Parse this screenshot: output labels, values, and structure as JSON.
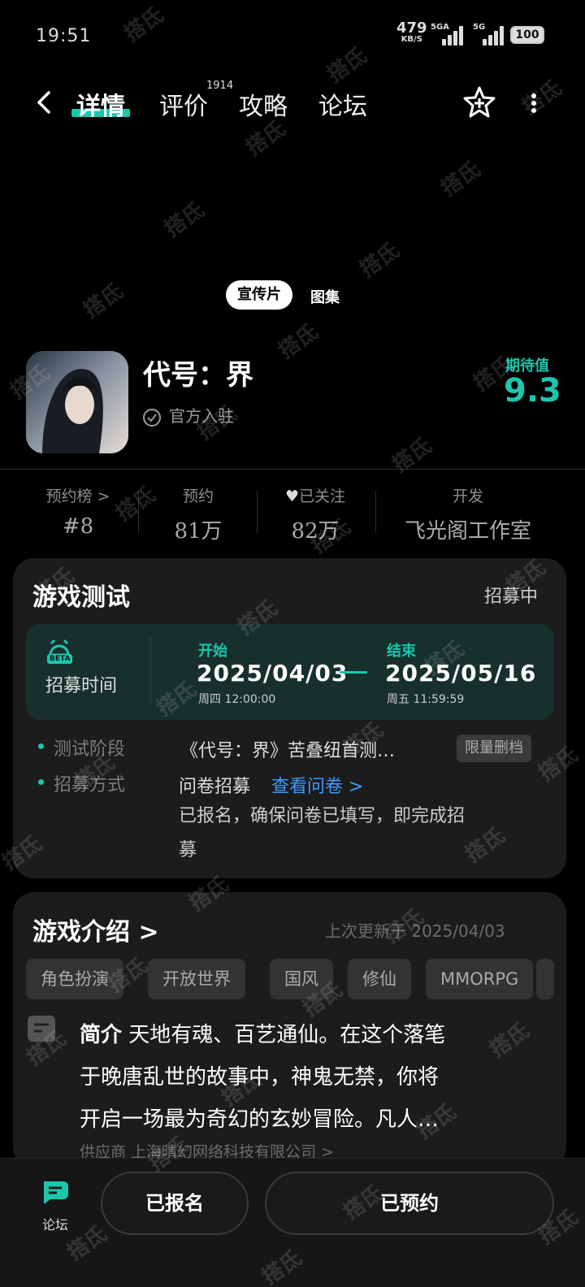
{
  "status_bar": {
    "time": "19:51",
    "net_speed": "479",
    "net_unit": "KB/S",
    "signal1_label": "5GA",
    "signal2_label": "5G",
    "battery": "100"
  },
  "nav": {
    "tabs": [
      {
        "label": "详情"
      },
      {
        "label": "评价"
      },
      {
        "label": "攻略"
      },
      {
        "label": "论坛"
      }
    ],
    "review_count": "1914"
  },
  "media": {
    "video_label": "宣传片",
    "gallery_label": "图集"
  },
  "game": {
    "name": "代号：界",
    "official_label": "官方入驻",
    "rating_label": "期待值",
    "rating_value": "9.3"
  },
  "stats": [
    {
      "label": "预约榜 >",
      "value": "#8"
    },
    {
      "label": "预约",
      "value": "81万"
    },
    {
      "label": "已关注",
      "value": "82万"
    },
    {
      "label": "开发",
      "value": "飞光阁工作室"
    }
  ],
  "test_card": {
    "title": "游戏测试",
    "status": "招募中",
    "recruit_time_label": "招募时间",
    "beta": "BETA",
    "start_label": "开始",
    "start_date": "2025/04/03",
    "start_sub": "周四 12:00:00",
    "end_label": "结束",
    "end_date": "2025/05/16",
    "end_sub": "周五 11:59:59",
    "phase_label": "测试阶段",
    "phase_value": "《代号：界》苦叠纽首测…",
    "phase_chip": "限量删档",
    "method_label": "招募方式",
    "method_value": "问卷招募",
    "method_link": "查看问卷 >",
    "status_note_line1": "已报名，确保问卷已填写，即完成招",
    "status_note_line2": "募"
  },
  "intro_card": {
    "title": "游戏介绍 >",
    "updated": "上次更新于 2025/04/03",
    "tags": [
      "角色扮演",
      "开放世界",
      "国风",
      "修仙",
      "MMORPG"
    ],
    "intro_label": "简介",
    "intro_text_1": "天地有魂、百艺通仙。在这个落笔",
    "intro_text_2": "于晚唐乱世的故事中，神鬼无禁，你将",
    "intro_text_3": "开启一场最为奇幻的玄妙冒险。凡人…",
    "supplier": "供应商 上海晴幻网络科技有限公司 >"
  },
  "bottom_bar": {
    "forum_label": "论坛",
    "registered_button": "已报名",
    "reserved_button": "已预约"
  },
  "watermark": "搭氐",
  "colors": {
    "accent": "#1bc6ae",
    "link": "#3b9bff",
    "card_bg": "#1c1c1c"
  }
}
